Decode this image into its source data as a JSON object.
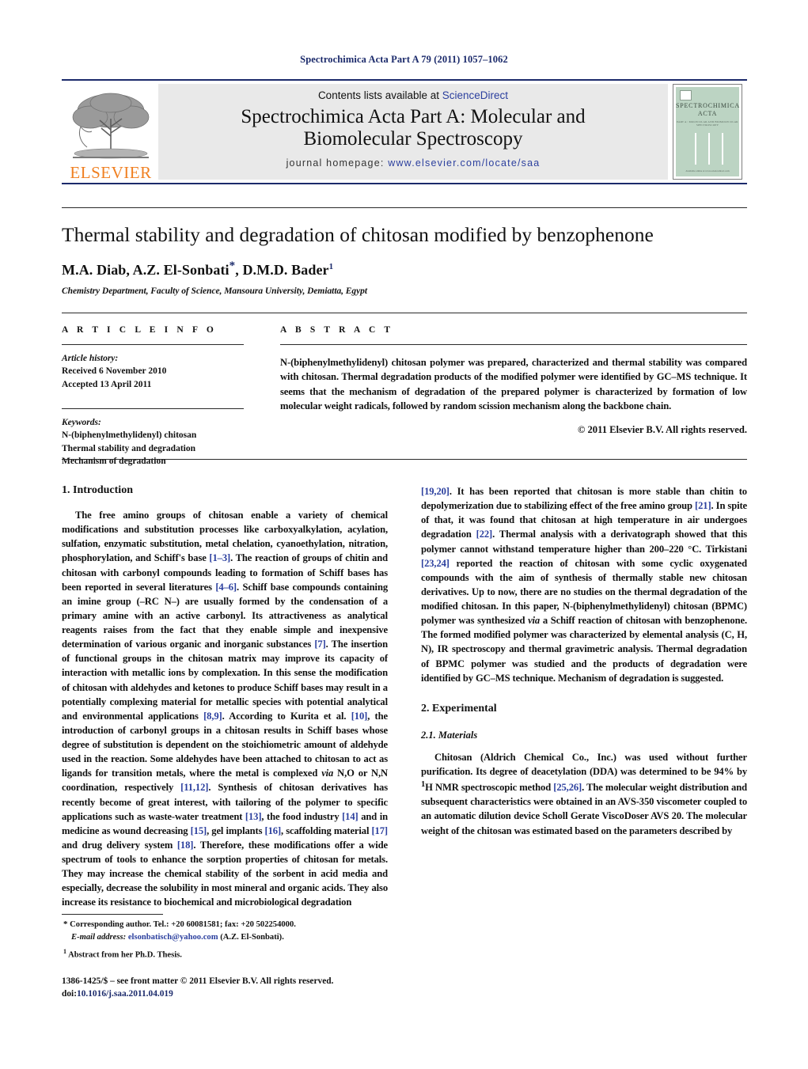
{
  "running_head": "Spectrochimica Acta Part A 79 (2011) 1057–1062",
  "masthead": {
    "contents_prefix": "Contents lists available at ",
    "sciencedirect": "ScienceDirect",
    "journal_title_line1": "Spectrochimica Acta Part A: Molecular and",
    "journal_title_line2": "Biomolecular Spectroscopy",
    "homepage_label": "journal homepage:",
    "homepage_url": "www.elsevier.com/locate/saa",
    "publisher_wordmark": "ELSEVIER",
    "cover": {
      "title_line1": "SPECTROCHIMICA",
      "title_line2": "ACTA",
      "subtitle": "PART A : MOLECULAR AND BIOMOLECULAR SPECTROSCOPY",
      "footer": "Available online at www.sciencedirect.com"
    }
  },
  "article": {
    "title": "Thermal stability and degradation of chitosan modified by benzophenone",
    "authors": "M.A. Diab, A.Z. El-Sonbati",
    "authors_tail": ", D.M.D. Bader",
    "corresponding_marker": "*",
    "footnote_marker": "1",
    "affiliation": "Chemistry Department, Faculty of Science, Mansoura University, Demiatta, Egypt"
  },
  "info": {
    "heading": "A R T I C L E   I N F O",
    "history_label": "Article history:",
    "received": "Received 6 November 2010",
    "accepted": "Accepted 13 April 2011",
    "keywords_label": "Keywords:",
    "keywords": [
      "N-(biphenylmethylidenyl) chitosan",
      "Thermal stability and degradation",
      "Mechanism of degradation"
    ]
  },
  "abstract": {
    "heading": "A B S T R A C T",
    "text": "N-(biphenylmethylidenyl) chitosan polymer was prepared, characterized and thermal stability was compared with chitosan. Thermal degradation products of the modified polymer were identified by GC–MS technique. It seems that the mechanism of degradation of the prepared polymer is characterized by formation of low molecular weight radicals, followed by random scission mechanism along the backbone chain.",
    "copyright": "© 2011 Elsevier B.V. All rights reserved."
  },
  "sections": {
    "introduction_heading": "1. Introduction",
    "intro_p1_a": "The free amino groups of chitosan enable a variety of chemical modifications and substitution processes like carboxyalkylation, acylation, sulfation, enzymatic substitution, metal chelation, cyanoethylation, nitration, phosphorylation, and Schiff's base ",
    "intro_ref_1_3": "[1–3]",
    "intro_p1_b": ". The reaction of groups of chitin and chitosan with carbonyl compounds leading to formation of Schiff bases has been reported in several literatures ",
    "intro_ref_4_6": "[4–6]",
    "intro_p1_c": ". Schiff base compounds containing an imine group (–RC N–) are usually formed by the condensation of a primary amine with an active carbonyl. Its attractiveness as analytical reagents raises from the fact that they enable simple and inexpensive determination of various organic and inorganic substances ",
    "intro_ref_7": "[7]",
    "intro_p1_d": ". The insertion of functional groups in the chitosan matrix may improve its capacity of interaction with metallic ions by complexation. In this sense the modification of chitosan with aldehydes and ketones to produce Schiff bases may result in a potentially complexing material for metallic species with potential analytical and environmental applications ",
    "intro_ref_8_9": "[8,9]",
    "intro_p1_e": ". According to Kurita et al. ",
    "intro_ref_10": "[10]",
    "intro_p1_f": ", the introduction of carbonyl groups in a chitosan results in Schiff bases whose degree of substitution is dependent on the stoichiometric amount of aldehyde used in the reaction. Some aldehydes have been attached to chitosan to act as ligands for transition metals, where the metal is complexed ",
    "via_1": "via",
    "intro_p1_g": " N,O or N,N coordination, respectively ",
    "intro_ref_11_12": "[11,12]",
    "intro_p1_h": ". Synthesis of chitosan derivatives has recently become of great interest, with tailoring of the polymer to specific applications such as waste-water treatment ",
    "intro_ref_13": "[13]",
    "intro_p1_i": ", the food industry ",
    "intro_ref_14": "[14]",
    "intro_p1_j": " and in medicine as wound decreasing ",
    "intro_ref_15": "[15]",
    "intro_p1_k": ", gel implants ",
    "intro_ref_16": "[16]",
    "intro_p1_l": ", scaffolding material ",
    "intro_ref_17": "[17]",
    "intro_p1_m": " and drug delivery system ",
    "intro_ref_18": "[18]",
    "intro_p1_n": ". Therefore, these modifications offer a wide spectrum of tools to enhance the sorption properties of chitosan for metals. They may increase the chemical stability of the sorbent in acid media and especially, decrease the solubility in most mineral and organic acids. They also increase its resistance to biochemical and microbiological degradation ",
    "intro_ref_19_20": "[19,20]",
    "intro_p1_o": ". It has been reported that chitosan is more stable than chitin to depolymerization due to stabilizing effect of the free amino group ",
    "intro_ref_21": "[21]",
    "intro_p1_p": ". In spite of that, it was found that chitosan at high temperature in air undergoes degradation ",
    "intro_ref_22": "[22]",
    "intro_p1_q": ". Thermal analysis with a derivatograph showed that this polymer cannot withstand temperature higher than 200–220 °C. Tirkistani ",
    "intro_ref_23_24": "[23,24]",
    "intro_p1_r": " reported the reaction of chitosan with some cyclic oxygenated compounds with the aim of synthesis of thermally stable new chitosan derivatives. Up to now, there are no studies on the thermal degradation of the modified chitosan. In this paper, N-(biphenylmethylidenyl) chitosan (BPMC) polymer was synthesized ",
    "via_2": "via",
    "intro_p1_s": " a Schiff reaction of chitosan with benzophenone. The formed modified polymer was characterized by elemental analysis (C, H, N), IR spectroscopy and thermal gravimetric analysis. Thermal degradation of BPMC polymer was studied and the products of degradation were identified by GC–MS technique. Mechanism of degradation is suggested.",
    "experimental_heading": "2. Experimental",
    "materials_heading": "2.1. Materials",
    "materials_p1_a": "Chitosan (Aldrich Chemical Co., Inc.) was used without further purification. Its degree of deacetylation (DDA) was determined to be 94% by ",
    "materials_sup": "1",
    "materials_p1_b": "H NMR spectroscopic method ",
    "materials_ref_25_26": "[25,26]",
    "materials_p1_c": ". The molecular weight distribution and subsequent characteristics were obtained in an AVS-350 viscometer coupled to an automatic dilution device Scholl Gerate ViscoDoser AVS 20. The molecular weight of the chitosan was estimated based on the parameters described by"
  },
  "footnotes": {
    "corresponding_mark": "*",
    "corresponding_text": " Corresponding author. Tel.: +20 60081581; fax: +20 502254000.",
    "email_label": "E-mail address:",
    "email": "elsonbatisch@yahoo.com",
    "email_attrib": " (A.Z. El-Sonbati).",
    "thesis_mark": "1",
    "thesis_text": " Abstract from her Ph.D. Thesis."
  },
  "imprint": {
    "line1": "1386-1425/$ – see front matter © 2011 Elsevier B.V. All rights reserved.",
    "doi_label": "doi:",
    "doi_value": "10.1016/j.saa.2011.04.019"
  },
  "colors": {
    "header_blue": "#1b2a6b",
    "link_blue": "#2b3f9e",
    "elsevier_orange": "#f08022",
    "masthead_gray": "#e9e9e9",
    "cover_green": "#bcd4c3"
  }
}
